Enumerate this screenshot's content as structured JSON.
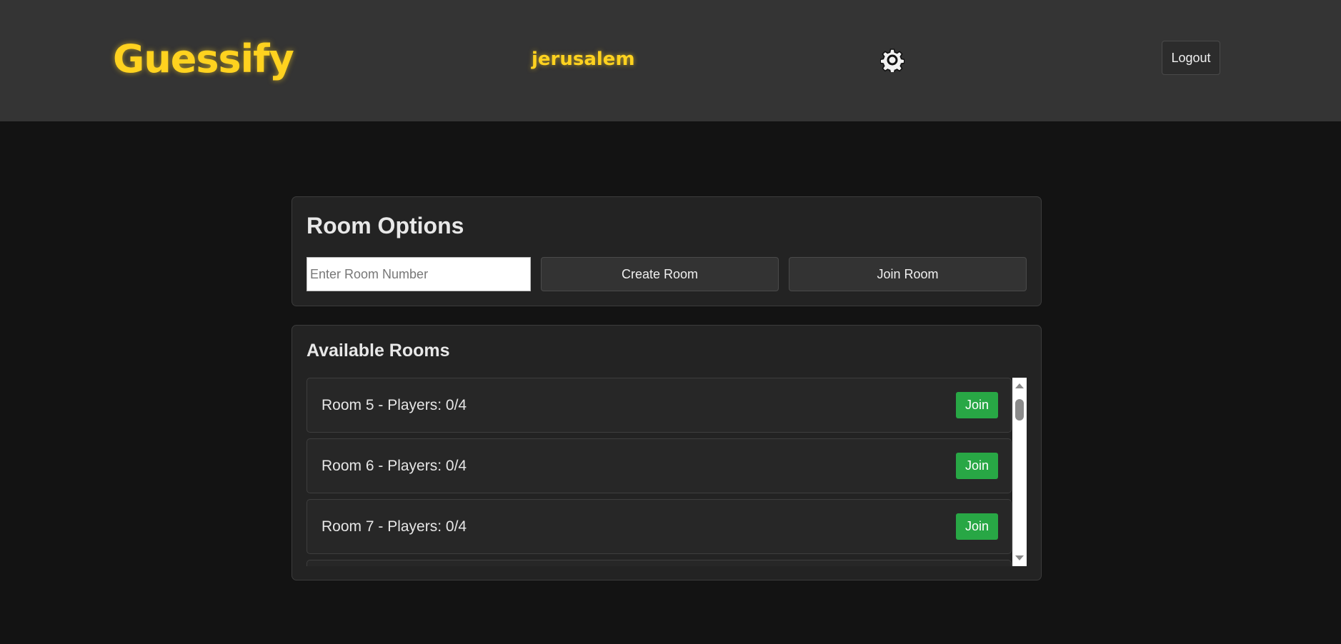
{
  "header": {
    "logo": "Guessify",
    "username": "jerusalem",
    "settings_icon": "gear-icon",
    "logout_label": "Logout"
  },
  "room_options": {
    "title": "Room Options",
    "room_input": {
      "placeholder": "Enter Room Number",
      "value": ""
    },
    "create_label": "Create Room",
    "join_label": "Join Room"
  },
  "available_rooms": {
    "title": "Available Rooms",
    "rooms": [
      {
        "label": "Room 5 - Players: 0/4",
        "join_label": "Join"
      },
      {
        "label": "Room 6 - Players: 0/4",
        "join_label": "Join"
      },
      {
        "label": "Room 7 - Players: 0/4",
        "join_label": "Join"
      }
    ]
  },
  "colors": {
    "accent": "#ffd21f",
    "join_green": "#28a745",
    "header_bg": "#343434",
    "page_bg": "#131313"
  }
}
